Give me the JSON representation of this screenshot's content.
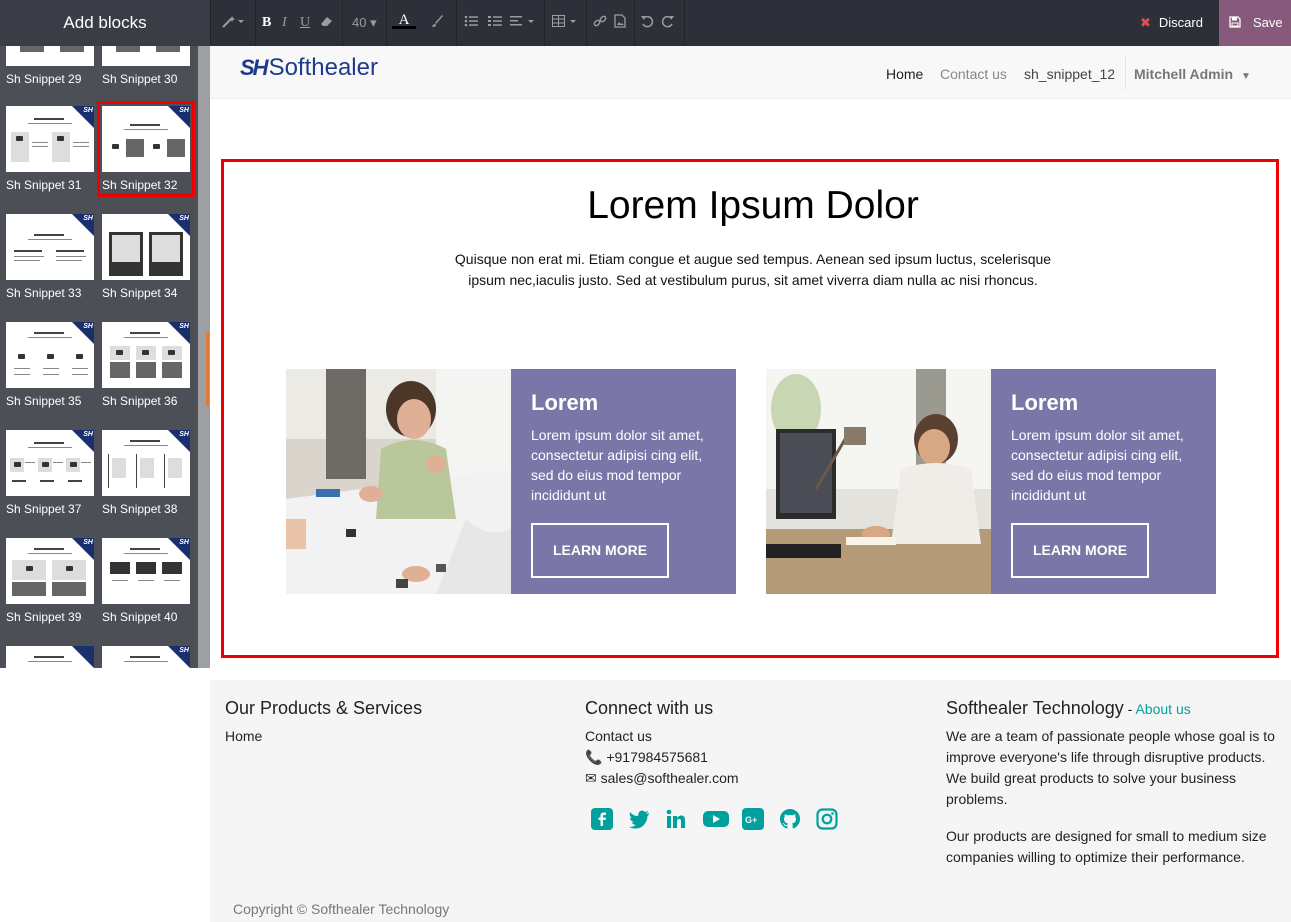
{
  "sidebar": {
    "title": "Add blocks",
    "snippets": [
      {
        "label": "Sh Snippet 29"
      },
      {
        "label": "Sh Snippet 30"
      },
      {
        "label": "Sh Snippet 31"
      },
      {
        "label": "Sh Snippet 32",
        "selected": true
      },
      {
        "label": "Sh Snippet 33"
      },
      {
        "label": "Sh Snippet 34"
      },
      {
        "label": "Sh Snippet 35"
      },
      {
        "label": "Sh Snippet 36"
      },
      {
        "label": "Sh Snippet 37"
      },
      {
        "label": "Sh Snippet 38"
      },
      {
        "label": "Sh Snippet 39"
      },
      {
        "label": "Sh Snippet 40"
      }
    ],
    "badge_text": "SH"
  },
  "toolbar": {
    "font_size": "40",
    "discard_label": "Discard",
    "save_label": "Save",
    "icons": [
      "magic-wand-icon",
      "bold-icon",
      "italic-icon",
      "underline-icon",
      "eraser-icon",
      "font-color-icon",
      "highlight-icon",
      "bullet-list-icon",
      "numbered-list-icon",
      "align-icon",
      "table-icon",
      "link-icon",
      "image-icon",
      "undo-icon",
      "redo-icon"
    ]
  },
  "navbar": {
    "logo_mark": "SH",
    "logo_text": "Softhealer",
    "links": [
      "Home",
      "Contact us",
      "sh_snippet_12"
    ],
    "user": "Mitchell Admin"
  },
  "snippet": {
    "title": "Lorem Ipsum Dolor",
    "description": "Quisque non erat mi. Etiam congue et augue sed tempus. Aenean sed ipsum luctus, scelerisque ipsum nec,iaculis justo. Sed at vestibulum purus, sit amet viverra diam nulla ac nisi rhoncus.",
    "cards": [
      {
        "title": "Lorem",
        "text": "Lorem ipsum dolor sit amet, consectetur adipisi cing elit, sed do eius mod tempor incididunt ut",
        "button": "LEARN MORE"
      },
      {
        "title": "Lorem",
        "text": "Lorem ipsum dolor sit amet, consectetur adipisi cing elit, sed do eius mod tempor incididunt ut",
        "button": "LEARN MORE"
      }
    ]
  },
  "footer": {
    "col1": {
      "title": "Our Products & Services",
      "link": "Home"
    },
    "col2": {
      "title": "Connect with us",
      "link": "Contact us",
      "phone": "+917984575681",
      "email": "sales@softhealer.com"
    },
    "col3": {
      "title": "Softhealer Technology",
      "title_sep": " - ",
      "about": "About us",
      "p1": "We are a team of passionate people whose goal is to improve everyone's life through disruptive products. We build great products to solve your business problems.",
      "p2": "Our products are designed for small to medium size companies willing to optimize their performance."
    },
    "social": [
      "facebook-icon",
      "twitter-icon",
      "linkedin-icon",
      "youtube-icon",
      "google-plus-icon",
      "github-icon",
      "instagram-icon"
    ],
    "copyright": "Copyright © Softhealer Technology"
  },
  "colors": {
    "accent": "#875a7b",
    "link": "#00a09d",
    "card": "#7b76a8",
    "highlight": "#ee0000"
  }
}
